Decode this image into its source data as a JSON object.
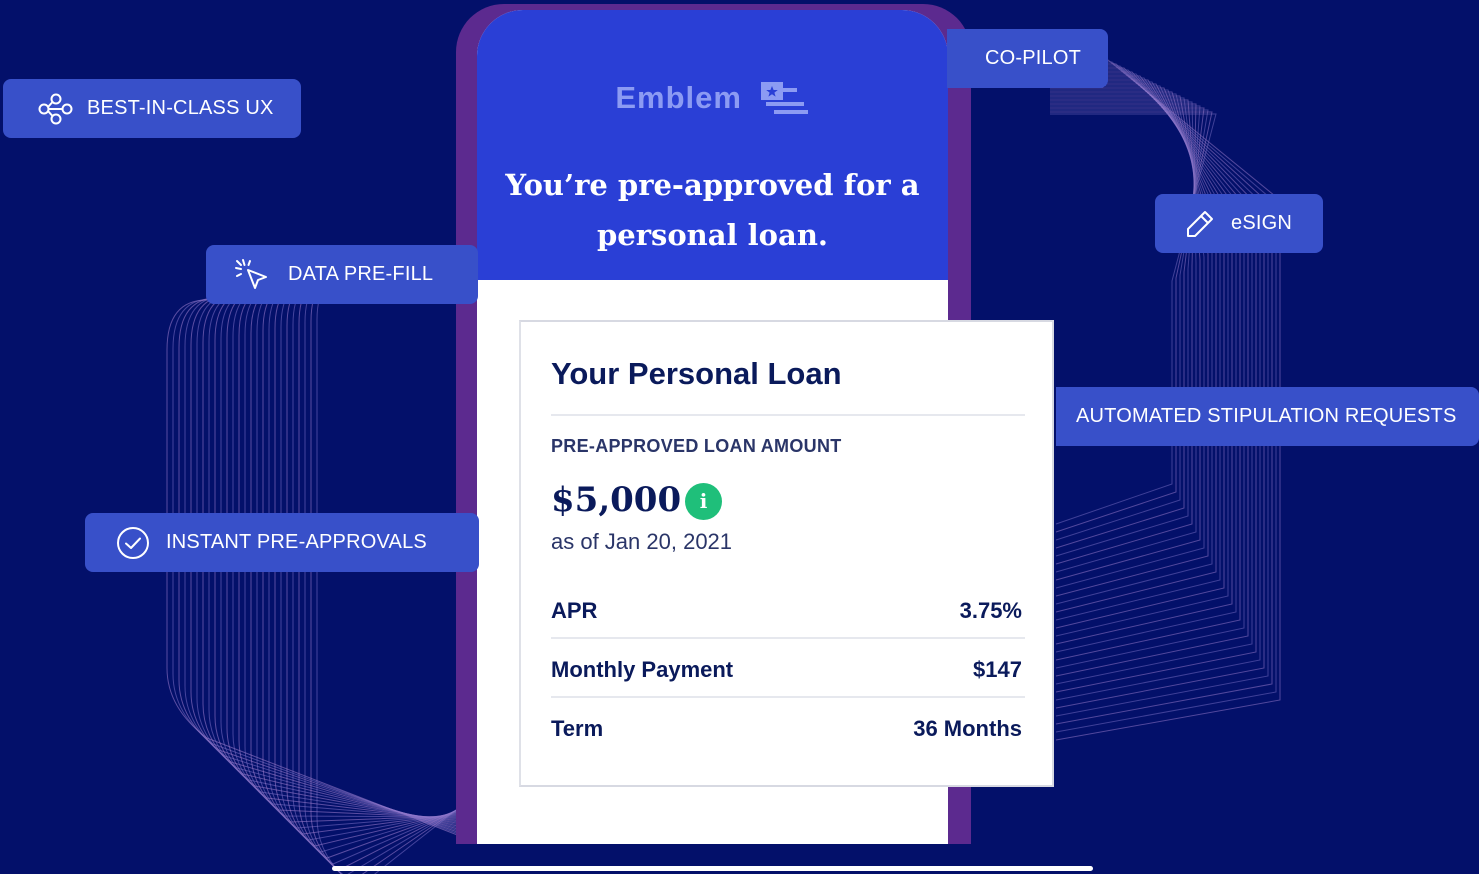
{
  "brand": {
    "name": "Emblem"
  },
  "hero": {
    "line1": "You’re pre-approved for a",
    "line2": "personal loan."
  },
  "loan_card": {
    "title": "Your Personal Loan",
    "amount_label": "PRE-APPROVED LOAN AMOUNT",
    "amount": "$5,000",
    "info_icon_glyph": "i",
    "as_of": "as of Jan 20, 2021",
    "rows": [
      {
        "label": "APR",
        "value": "3.75%"
      },
      {
        "label": "Monthly Payment",
        "value": "$147"
      },
      {
        "label": "Term",
        "value": "36 Months"
      }
    ]
  },
  "features": {
    "best_in_class": {
      "label": "BEST-IN-CLASS UX",
      "icon": "share-network-icon"
    },
    "data_prefill": {
      "label": "DATA PRE-FILL",
      "icon": "cursor-click-icon"
    },
    "instant_preapprovals": {
      "label": "INSTANT PRE-APPROVALS",
      "icon": "check-circle-icon"
    },
    "copilot": {
      "label": "CO-PILOT"
    },
    "esign": {
      "label": "eSIGN",
      "icon": "pencil-icon"
    },
    "stipulation": {
      "label": "AUTOMATED STIPULATION REQUESTS"
    }
  },
  "colors": {
    "background": "#03106a",
    "phone_header": "#2a3fd6",
    "chip": "#3850c9",
    "phone_frame": "#5c2a8f",
    "info_green": "#1fbf7a",
    "text_navy": "#0a1a5b"
  }
}
